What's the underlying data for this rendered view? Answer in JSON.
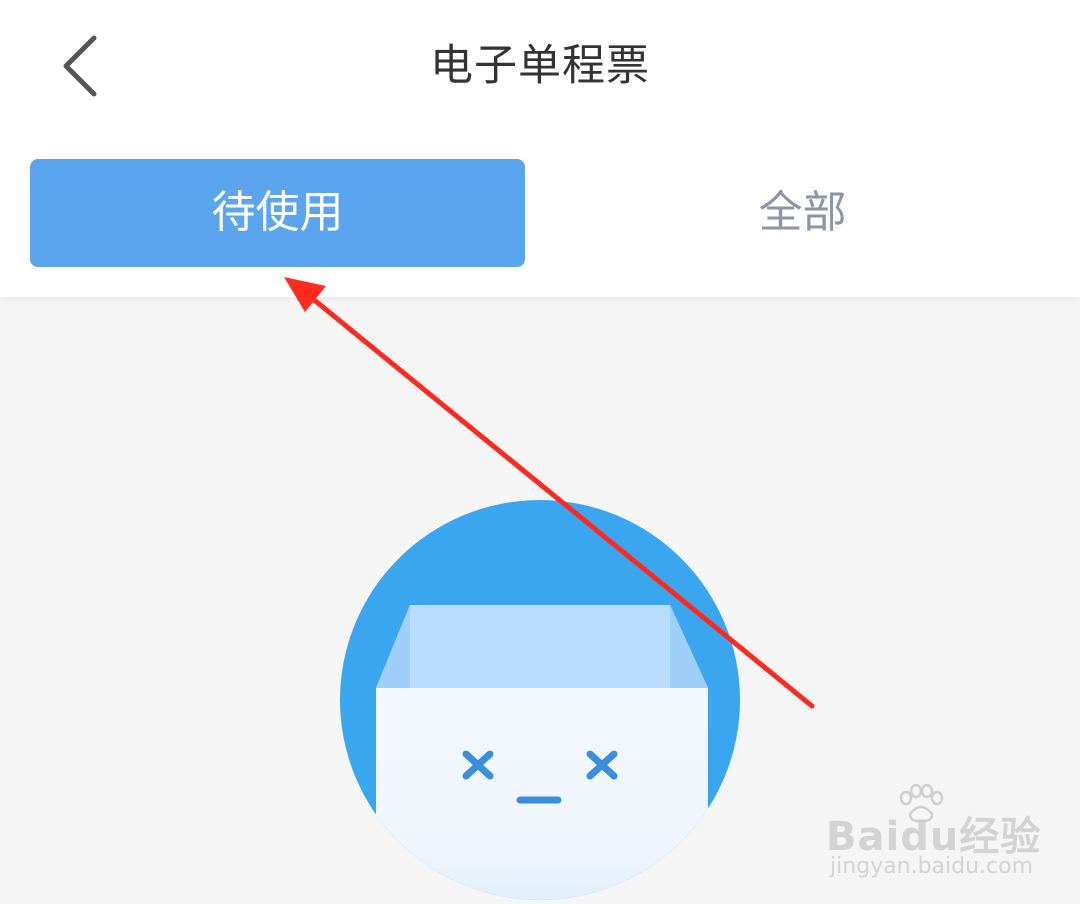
{
  "header": {
    "title": "电子单程票",
    "back_icon": "chevron-left-icon"
  },
  "tabs": [
    {
      "label": "待使用",
      "active": true
    },
    {
      "label": "全部",
      "active": false
    }
  ],
  "empty_state": {
    "illustration": "empty-box-face-icon"
  },
  "watermark": {
    "brand": "Baidu经验",
    "url": "jingyan.baidu.com"
  },
  "colors": {
    "tab_active_bg": "#5aa5ed",
    "tab_active_text": "#ffffff",
    "tab_inactive_text": "#8a95a8",
    "title_text": "#333333",
    "page_bg": "#f5f5f5",
    "illustration_circle": "#3aa6ef",
    "annotation_arrow": "#ff2a1f"
  }
}
